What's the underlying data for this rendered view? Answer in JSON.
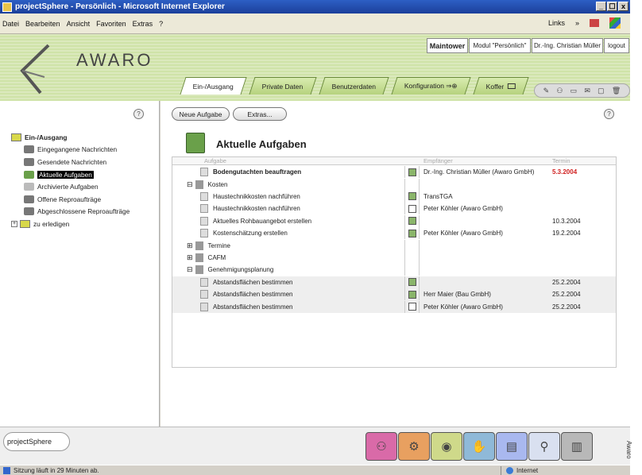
{
  "window": {
    "title": "projectSphere - Persönlich - Microsoft Internet Explorer",
    "controls": [
      "_",
      "☐",
      "x"
    ]
  },
  "menu": {
    "items": [
      "Datei",
      "Bearbeiten",
      "Ansicht",
      "Favoriten",
      "Extras",
      "?"
    ],
    "links_label": "Links",
    "links_chevron": "»"
  },
  "brand": {
    "logo_text": "AWARO"
  },
  "userbar": {
    "project": "Maintower",
    "module": "Modul \"Persönlich\"",
    "user": "Dr.-Ing. Christian Müller",
    "logout": "logout"
  },
  "tabs": [
    {
      "label": "Ein-/Ausgang",
      "active": true
    },
    {
      "label": "Private Daten",
      "active": false
    },
    {
      "label": "Benutzerdaten",
      "active": false
    },
    {
      "label": "Konfiguration ⇒⊕",
      "active": false
    },
    {
      "label": "Koffer",
      "active": false
    }
  ],
  "quick_toolbar": {
    "icons": [
      "pen-icon",
      "people-icon",
      "card-icon",
      "mail-icon",
      "folder-icon",
      "trash-icon"
    ]
  },
  "left": {
    "help_symbol": "?",
    "tree": [
      {
        "label": "Ein-/Ausgang",
        "level": 0,
        "bold": true,
        "icon": "folder-open-icon"
      },
      {
        "label": "Eingegangene Nachrichten",
        "level": 1,
        "icon": "tray-icon"
      },
      {
        "label": "Gesendete Nachrichten",
        "level": 1,
        "icon": "tray-icon"
      },
      {
        "label": "Aktuelle Aufgaben",
        "level": 1,
        "icon": "clipboard-icon",
        "selected": true
      },
      {
        "label": "Archivierte Aufgaben",
        "level": 1,
        "icon": "archive-icon"
      },
      {
        "label": "Offene Reproaufträge",
        "level": 1,
        "icon": "printer-icon"
      },
      {
        "label": "Abgeschlossene Reproaufträge",
        "level": 1,
        "icon": "printer-icon"
      },
      {
        "label": "zu erledigen",
        "level": 0,
        "icon": "folder-icon",
        "expander": "+"
      }
    ]
  },
  "main": {
    "new_task_button": "Neue Aufgabe",
    "extras_button": "Extras...",
    "help_symbol": "?",
    "heading": "Aktuelle Aufgaben",
    "columns": {
      "task": "Aufgabe",
      "recipient": "Empfänger",
      "date": "Termin"
    },
    "rows": [
      {
        "task": "Bodengutachten beauftragen",
        "bold": true,
        "kind": "task",
        "mark": "filled",
        "recipient": "Dr.-Ing. Christian Müller (Awaro GmbH)",
        "date": "5.3.2004",
        "date_color": "#d02020",
        "shaded": false
      },
      {
        "task": "Kosten",
        "kind": "group",
        "expander": "⊟",
        "mark": "",
        "recipient": "",
        "date": "",
        "shaded": false
      },
      {
        "task": "Haustechnikkosten nachführen",
        "kind": "task",
        "mark": "filled",
        "recipient": "TransTGA",
        "date": "",
        "shaded": false
      },
      {
        "task": "Haustechnikkosten nachführen",
        "kind": "task",
        "mark": "empty",
        "recipient": "Peter Köhler (Awaro GmbH)",
        "date": "",
        "shaded": false
      },
      {
        "task": "Aktuelles Rohbauangebot erstellen",
        "kind": "task",
        "mark": "filled",
        "recipient": "",
        "date": "10.3.2004",
        "shaded": false
      },
      {
        "task": "Kostenschätzung erstellen",
        "kind": "task",
        "mark": "filled",
        "recipient": "Peter Köhler (Awaro GmbH)",
        "date": "19.2.2004",
        "shaded": false
      },
      {
        "task": "Termine",
        "kind": "group",
        "expander": "⊞",
        "mark": "",
        "recipient": "",
        "date": "",
        "shaded": false
      },
      {
        "task": "CAFM",
        "kind": "group",
        "expander": "⊞",
        "mark": "",
        "recipient": "",
        "date": "",
        "shaded": false
      },
      {
        "task": "Genehmigungsplanung",
        "kind": "group",
        "expander": "⊟",
        "mark": "",
        "recipient": "",
        "date": "",
        "shaded": false
      },
      {
        "task": "Abstandsflächen bestimmen",
        "kind": "task",
        "mark": "filled",
        "recipient": "",
        "date": "25.2.2004",
        "shaded": true
      },
      {
        "task": "Abstandsflächen bestimmen",
        "kind": "task",
        "mark": "filled",
        "recipient": "Herr Maier (Bau GmbH)",
        "date": "25.2.2004",
        "shaded": true
      },
      {
        "task": "Abstandsflächen bestimmen",
        "kind": "task",
        "mark": "empty",
        "recipient": "Peter Köhler (Awaro GmbH)",
        "date": "25.2.2004",
        "shaded": true
      }
    ]
  },
  "bottom": {
    "projectsphere_label": "projectSphere",
    "dock": [
      {
        "icon": "people-icon",
        "color": "#d96aa8"
      },
      {
        "icon": "gears-icon",
        "color": "#e8a060"
      },
      {
        "icon": "disc-icon",
        "color": "#cfd98a"
      },
      {
        "icon": "hand-icon",
        "color": "#8fb9d8"
      },
      {
        "icon": "document-icon",
        "color": "#a9b8ef"
      },
      {
        "icon": "magnifier-icon",
        "color": "#d9e0f0"
      },
      {
        "icon": "building-icon",
        "color": "#b8b8b8"
      }
    ]
  },
  "status": {
    "message": "Sitzung läuft in 29 Minuten ab.",
    "zone": "Internet"
  },
  "side_caption": "Awaro"
}
